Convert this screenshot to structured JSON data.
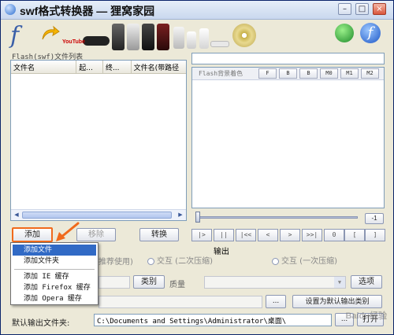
{
  "window": {
    "title": "swf格式转换器 — 狸窝家园",
    "minimize_glyph": "–",
    "maximize_glyph": "□",
    "close_glyph": "×"
  },
  "toolbar": {
    "flash_glyph": "f",
    "youtube_text": "YouTube",
    "download_icon": "download-globe-icon",
    "flash_circle_glyph": "f"
  },
  "file_list": {
    "section_label": "Flash(swf)文件列表",
    "columns": [
      "文件名",
      "起...",
      "终...",
      "文件名(带路径"
    ]
  },
  "preview": {
    "background_label": "Flash背景着色",
    "quality_buttons": [
      "F",
      "B",
      "B",
      "M0",
      "M1",
      "M2"
    ],
    "time_button": "-1",
    "play_controls": [
      "|>",
      "||",
      "|<<",
      "<",
      ">",
      ">>|",
      "0",
      "[",
      "]"
    ]
  },
  "actions": {
    "add_label": "添加",
    "remove_label": "移除",
    "convert_label": "转换"
  },
  "output": {
    "section_label": "输出",
    "recommended_text": "推荐使用)",
    "interactive_label": "交互 (二次压缩)",
    "interactive_once_label": "交互 (一次压缩)",
    "category_button": "类别",
    "quality_label": "质量",
    "options_button": "选项",
    "ellipsis_button": "...",
    "set_default_button": "设置为默认输出类别",
    "default_folder_label": "默认输出文件夹:",
    "default_folder_value": "C:\\Documents and Settings\\Administrator\\桌面\\",
    "folder_browse": "...",
    "open_button": "打开"
  },
  "add_menu": {
    "items": [
      "添加文件",
      "添加文件夹",
      "添加 IE 缓存",
      "添加 Firefox 缓存",
      "添加 Opera 缓存"
    ],
    "active_index": 0
  },
  "watermark": "Baidu经验",
  "colors": {
    "highlight": "#f06a1c",
    "menu_active": "#316ac5",
    "list_border": "#7f9db9"
  }
}
